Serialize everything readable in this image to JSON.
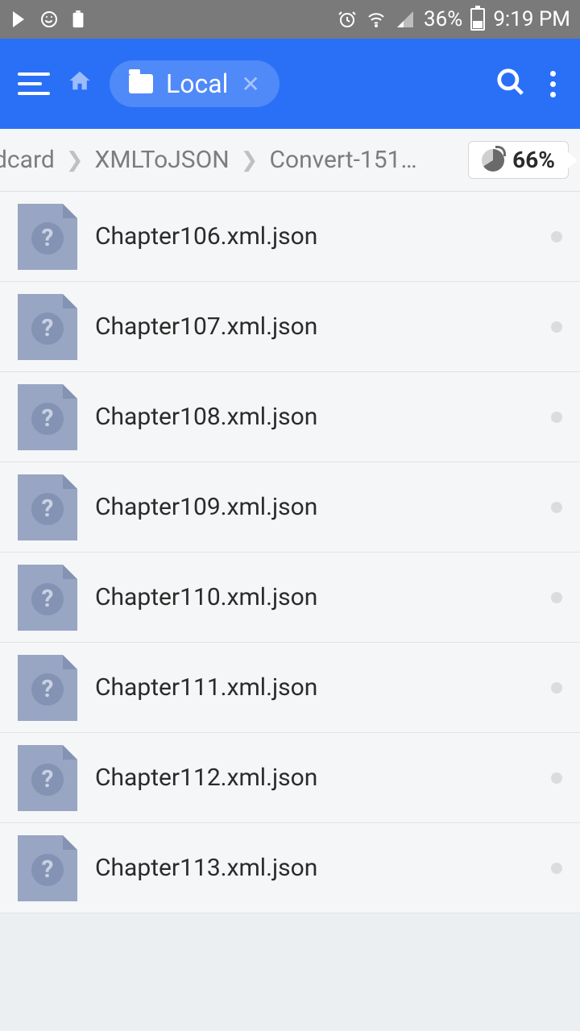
{
  "status": {
    "battery_pct": "36%",
    "time": "9:19 PM"
  },
  "appbar": {
    "tab_label": "Local"
  },
  "breadcrumb": {
    "items": [
      "dcard",
      "XMLToJSON",
      "Convert-151…"
    ],
    "storage_pct": "66%"
  },
  "files": [
    {
      "name": "Chapter106.xml.json"
    },
    {
      "name": "Chapter107.xml.json"
    },
    {
      "name": "Chapter108.xml.json"
    },
    {
      "name": "Chapter109.xml.json"
    },
    {
      "name": "Chapter110.xml.json"
    },
    {
      "name": "Chapter111.xml.json"
    },
    {
      "name": "Chapter112.xml.json"
    },
    {
      "name": "Chapter113.xml.json"
    }
  ]
}
